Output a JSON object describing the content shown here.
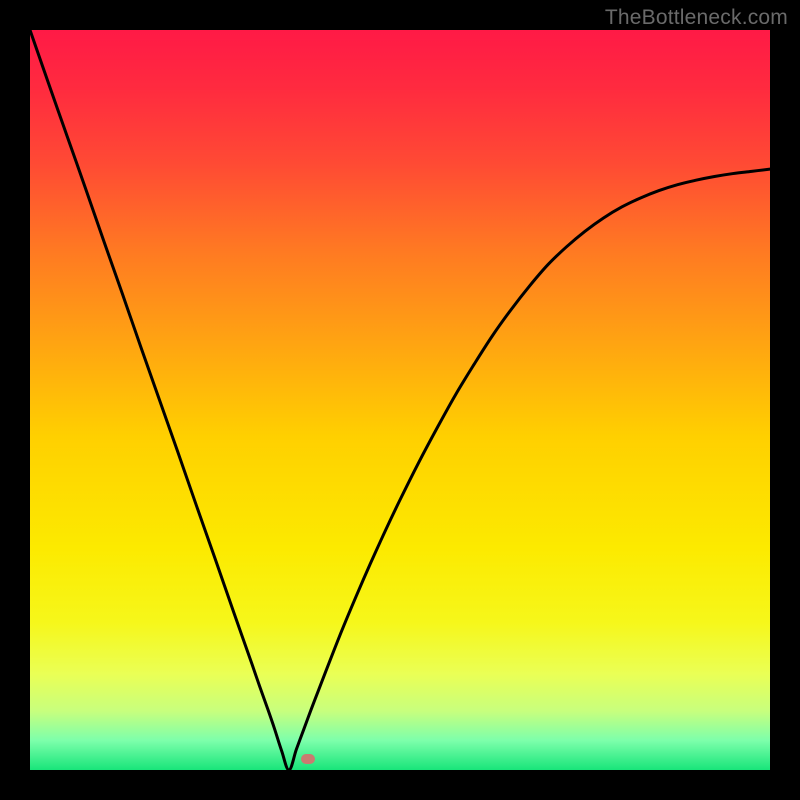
{
  "watermark": {
    "text": "TheBottleneck.com"
  },
  "gradient": {
    "stops": [
      {
        "offset": 0.0,
        "color": "#ff1a46"
      },
      {
        "offset": 0.08,
        "color": "#ff2b3f"
      },
      {
        "offset": 0.18,
        "color": "#ff4a34"
      },
      {
        "offset": 0.3,
        "color": "#ff7a22"
      },
      {
        "offset": 0.42,
        "color": "#ffa312"
      },
      {
        "offset": 0.55,
        "color": "#ffd000"
      },
      {
        "offset": 0.7,
        "color": "#fcea00"
      },
      {
        "offset": 0.8,
        "color": "#f6f71a"
      },
      {
        "offset": 0.87,
        "color": "#eaff55"
      },
      {
        "offset": 0.92,
        "color": "#c8ff7d"
      },
      {
        "offset": 0.96,
        "color": "#7dffab"
      },
      {
        "offset": 1.0,
        "color": "#18e57a"
      }
    ]
  },
  "marker": {
    "x_frac": 0.375,
    "y_frac": 0.985,
    "color": "#c97b70"
  },
  "chart_data": {
    "type": "line",
    "title": "",
    "xlabel": "",
    "ylabel": "",
    "xlim": [
      0,
      1
    ],
    "ylim": [
      0,
      1
    ],
    "x": [
      0.0,
      0.025,
      0.05,
      0.075,
      0.1,
      0.125,
      0.15,
      0.175,
      0.2,
      0.225,
      0.25,
      0.275,
      0.3,
      0.31,
      0.32,
      0.33,
      0.34,
      0.35,
      0.36,
      0.37,
      0.38,
      0.39,
      0.4,
      0.42,
      0.44,
      0.46,
      0.48,
      0.5,
      0.525,
      0.55,
      0.575,
      0.6,
      0.625,
      0.65,
      0.675,
      0.7,
      0.725,
      0.75,
      0.775,
      0.8,
      0.825,
      0.85,
      0.875,
      0.9,
      0.925,
      0.95,
      0.975,
      1.0
    ],
    "values": [
      1.0,
      0.928,
      0.857,
      0.786,
      0.714,
      0.643,
      0.571,
      0.5,
      0.429,
      0.357,
      0.286,
      0.214,
      0.143,
      0.114,
      0.086,
      0.057,
      0.026,
      0.0,
      0.028,
      0.055,
      0.082,
      0.108,
      0.134,
      0.185,
      0.233,
      0.279,
      0.323,
      0.365,
      0.415,
      0.462,
      0.507,
      0.548,
      0.587,
      0.622,
      0.654,
      0.683,
      0.707,
      0.728,
      0.746,
      0.761,
      0.773,
      0.783,
      0.791,
      0.797,
      0.802,
      0.806,
      0.809,
      0.812
    ],
    "minimum_marker": {
      "x": 0.375,
      "y": 0.015
    }
  },
  "labels": {
    "curve_name": "bottleneck-curve",
    "marker_name": "optimum-marker"
  }
}
